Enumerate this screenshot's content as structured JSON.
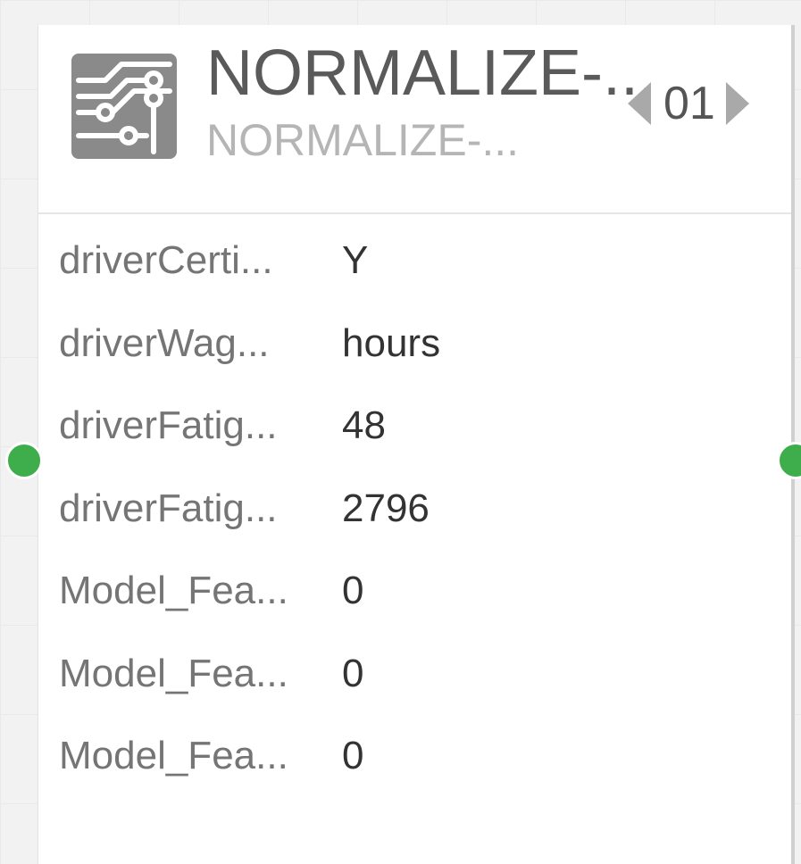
{
  "colors": {
    "port_green": "#3dae4b",
    "icon_gray": "#8a8a8a"
  },
  "node": {
    "icon": "circuit-board-icon",
    "title": "NORMALIZE-...",
    "subtitle": "NORMALIZE-...",
    "pager": {
      "value": "01",
      "prev_icon": "triangle-left-icon",
      "next_icon": "triangle-right-icon"
    },
    "properties": [
      {
        "key": "driverCerti...",
        "value": "Y"
      },
      {
        "key": "driverWag...",
        "value": "hours"
      },
      {
        "key": "driverFatig...",
        "value": "48"
      },
      {
        "key": "driverFatig...",
        "value": "2796"
      },
      {
        "key": "Model_Fea...",
        "value": "0"
      },
      {
        "key": "Model_Fea...",
        "value": "0"
      },
      {
        "key": "Model_Fea...",
        "value": "0"
      }
    ]
  }
}
